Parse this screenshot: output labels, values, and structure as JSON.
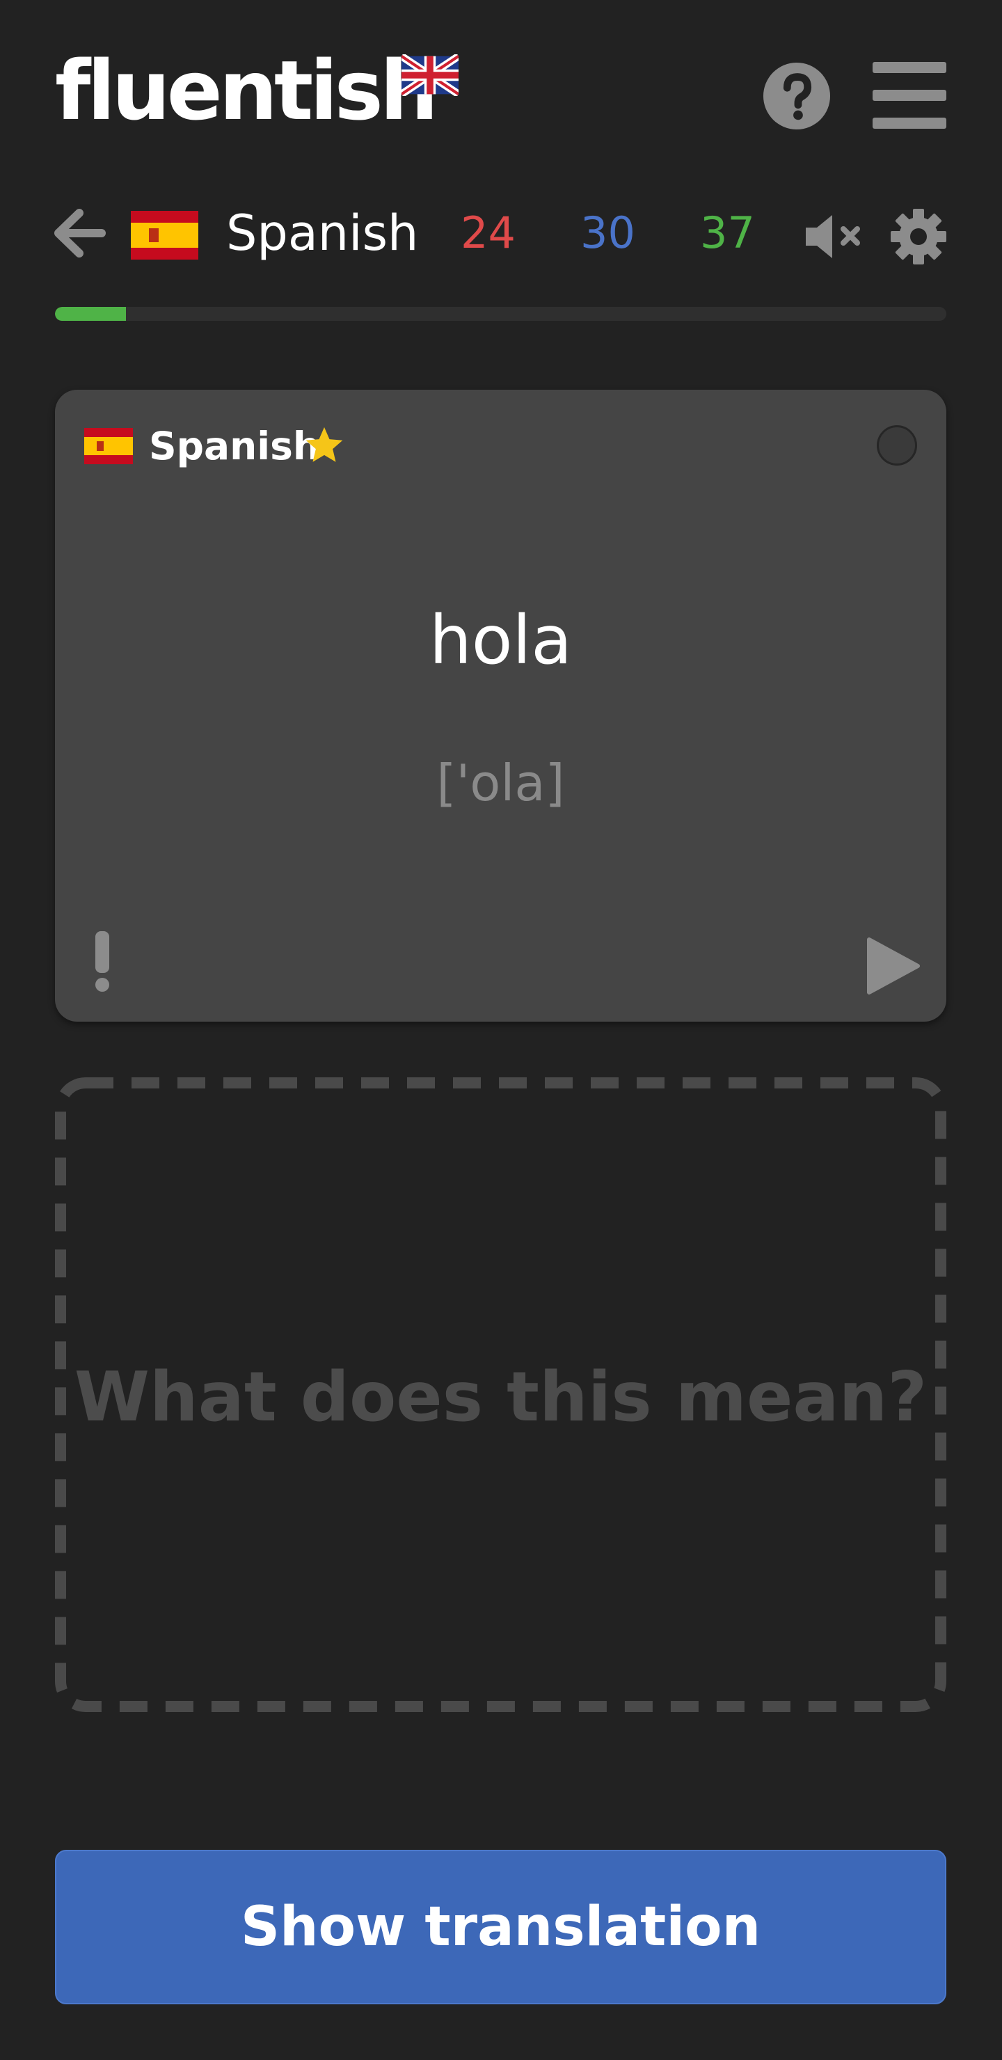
{
  "header": {
    "logo_text": "fluentish",
    "logo_flag_icon": "uk-flag-icon",
    "help_icon": "question-circle-icon",
    "menu_icon": "hamburger-menu-icon"
  },
  "nav": {
    "back_icon": "arrow-left-icon",
    "flag_icon": "spain-flag-icon",
    "language": "Spanish",
    "counts": {
      "red": "24",
      "blue": "30",
      "green": "37"
    },
    "mute_icon": "speaker-muted-icon",
    "settings_icon": "gear-icon",
    "progress": 0.08
  },
  "card": {
    "language": "Spanish",
    "flag_icon": "spain-flag-icon",
    "star_icon": "star-icon",
    "word": "hola",
    "phonetic": "['ola]",
    "report_icon": "exclamation-icon",
    "play_icon": "play-icon"
  },
  "answer": {
    "placeholder": "What does this mean?"
  },
  "button": {
    "label": "Show translation"
  },
  "colors": {
    "background": "#222222",
    "card": "#454545",
    "red": "#e04a4a",
    "blue": "#4a73c9",
    "green": "#4fb347",
    "button": "#3d68b8",
    "star": "#f5c518"
  }
}
